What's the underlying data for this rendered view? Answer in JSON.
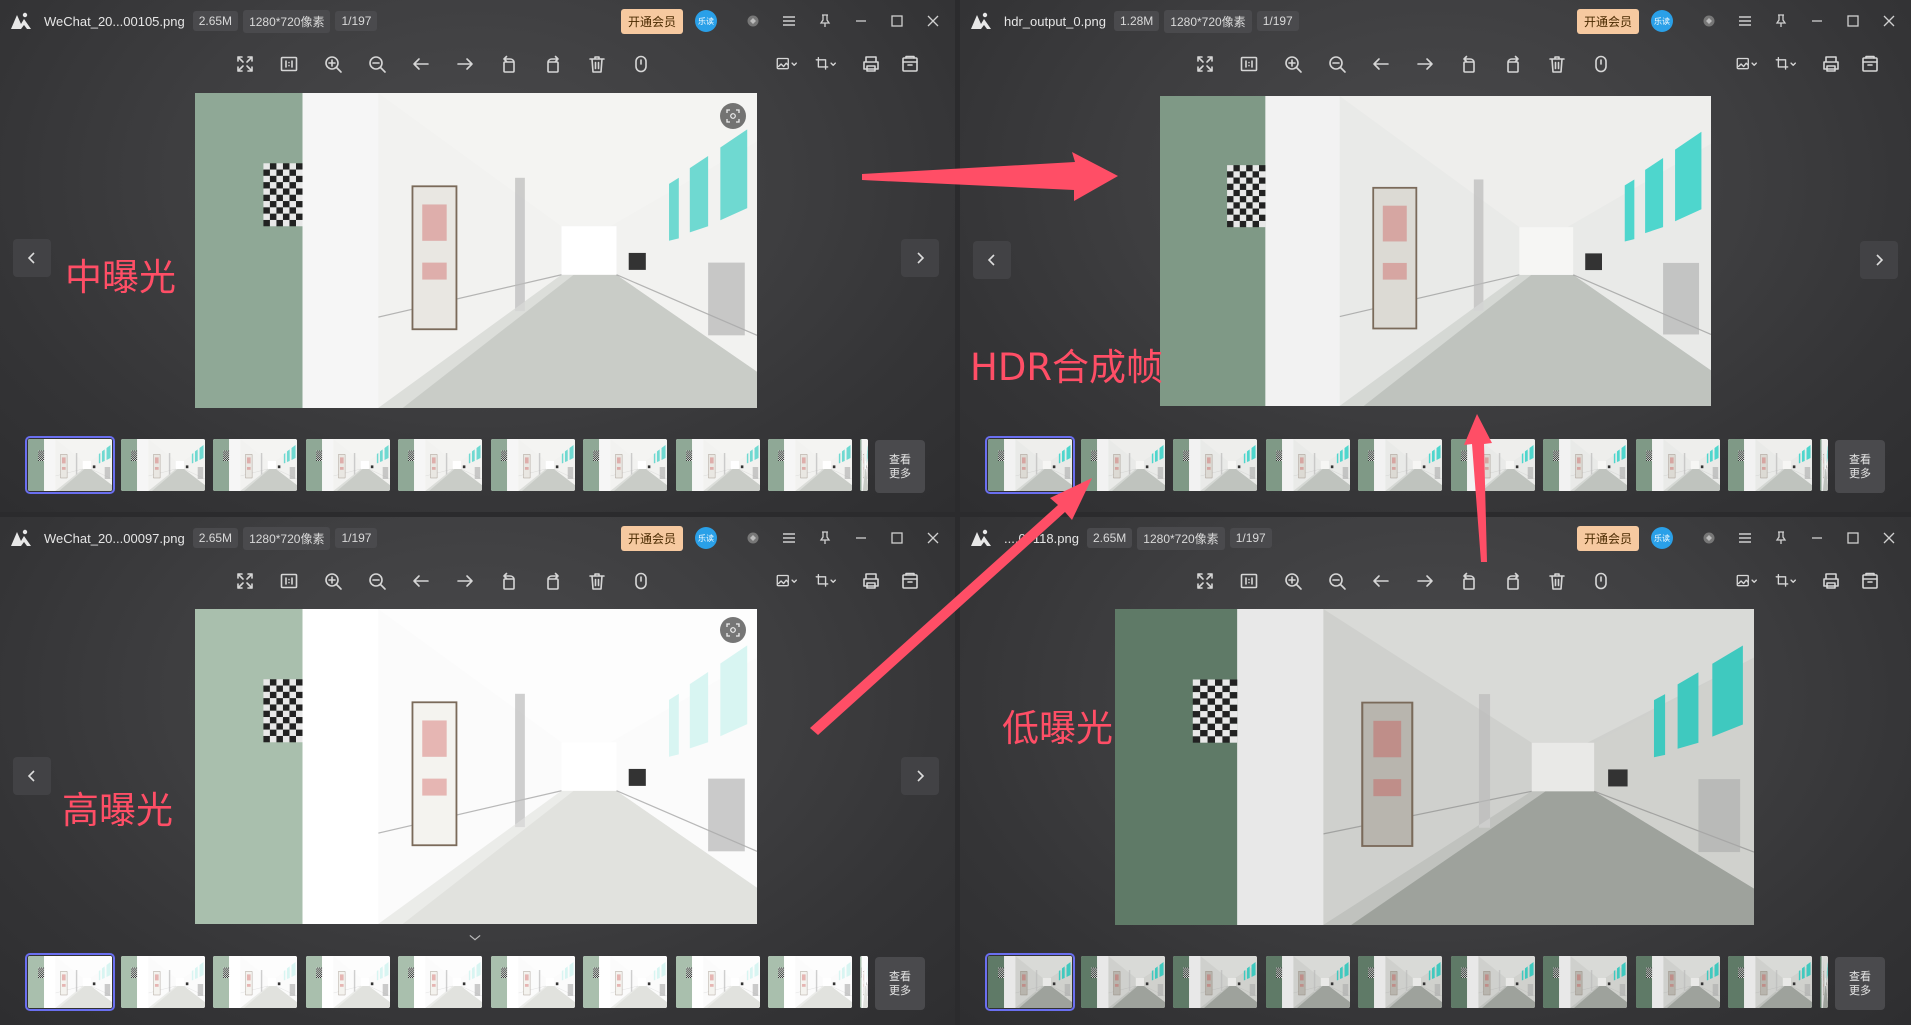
{
  "panels": [
    {
      "id": "mid",
      "filename": "WeChat_20...00105.png",
      "size": "2.65M",
      "resolution": "1280*720像素",
      "index": "1/197"
    },
    {
      "id": "hdr",
      "filename": "hdr_output_0.png",
      "size": "1.28M",
      "resolution": "1280*720像素",
      "index": "1/197"
    },
    {
      "id": "high",
      "filename": "WeChat_20...00097.png",
      "size": "2.65M",
      "resolution": "1280*720像素",
      "index": "1/197"
    },
    {
      "id": "low",
      "filename": "....00118.png",
      "size": "2.65M",
      "resolution": "1280*720像素",
      "index": "1/197"
    }
  ],
  "common": {
    "vip_label": "开通会员",
    "avatar_text": "乐读",
    "more_label": "查看\n更多"
  },
  "toolbar_icons": [
    "fullscreen-icon",
    "actual-size-icon",
    "zoom-in-icon",
    "zoom-out-icon",
    "previous-arrow-icon",
    "next-arrow-icon",
    "rotate-left-icon",
    "rotate-right-icon",
    "delete-icon",
    "info-icon",
    "image-edit-icon",
    "crop-icon",
    "print-icon",
    "save-icon"
  ],
  "annotations": {
    "mid": "中曝光",
    "hdr": "HDR合成帧",
    "high": "高曝光",
    "low": "低曝光"
  },
  "colors": {
    "annotation": "#ff4e66",
    "vip_bg": "#f6c9a0",
    "avatar": "#2aa0e8",
    "selection": "#6a6ff0"
  }
}
